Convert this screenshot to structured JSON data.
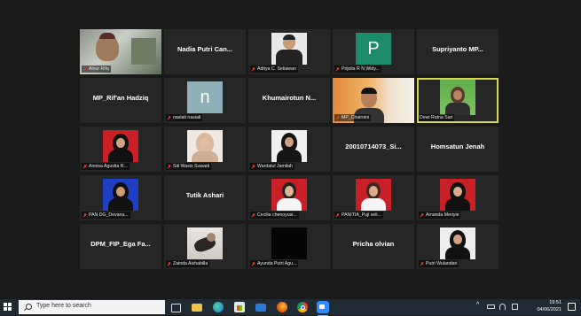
{
  "participants": [
    {
      "label": "Ainur Rifq",
      "big": ""
    },
    {
      "label": "",
      "big": "Nadia Putri Can..."
    },
    {
      "label": "Aditya C. Setiawan",
      "big": ""
    },
    {
      "label": "Prijolia R N Widy...",
      "big": "",
      "avatar": "P"
    },
    {
      "label": "",
      "big": "Supriyanto MP..."
    },
    {
      "label": "",
      "big": "MP_Rif'an Hadziq"
    },
    {
      "label": "nasiati nasiati",
      "big": "",
      "avatar": "n"
    },
    {
      "label": "",
      "big": "Khumairotun N..."
    },
    {
      "label": "MP_Chairoini",
      "big": ""
    },
    {
      "label": "Dewi Ratna Sari",
      "big": ""
    },
    {
      "label": "Annisa Agustia R...",
      "big": ""
    },
    {
      "label": "Siti Wasis Suwarti",
      "big": ""
    },
    {
      "label": "Wardatul Jamilah",
      "big": ""
    },
    {
      "label": "",
      "big": "20010714073_Si..."
    },
    {
      "label": "",
      "big": "Homsatun Jenah"
    },
    {
      "label": "PAN DG_Devana...",
      "big": ""
    },
    {
      "label": "",
      "big": "Tutik Ashari"
    },
    {
      "label": "Cecilia chenoyusi...",
      "big": ""
    },
    {
      "label": "PANITIA_Puji seli...",
      "big": ""
    },
    {
      "label": "Amanda Meriyie",
      "big": ""
    },
    {
      "label": "",
      "big": "DPM_FIP_Ega Fa..."
    },
    {
      "label": "Zainda Aishabilla",
      "big": ""
    },
    {
      "label": "Ayunda Putri Agu...",
      "big": ""
    },
    {
      "label": "",
      "big": "Pricha olvian"
    },
    {
      "label": "Putri Wulandari",
      "big": ""
    }
  ],
  "taskbar": {
    "search_placeholder": "Type here to search",
    "time": "19:51",
    "date": "04/06/2021",
    "apps": [
      "task-view",
      "file-explorer",
      "edge",
      "store",
      "mail",
      "firefox",
      "chrome",
      "zoom"
    ]
  },
  "colors": {
    "tile_bg": "#262626",
    "active_border": "#d6d84a",
    "muted_mic": "#e23a3a",
    "taskbar_bg": "#202a33",
    "avatar_green": "#1d8a6a",
    "avatar_gray": "#8fb0b8"
  }
}
